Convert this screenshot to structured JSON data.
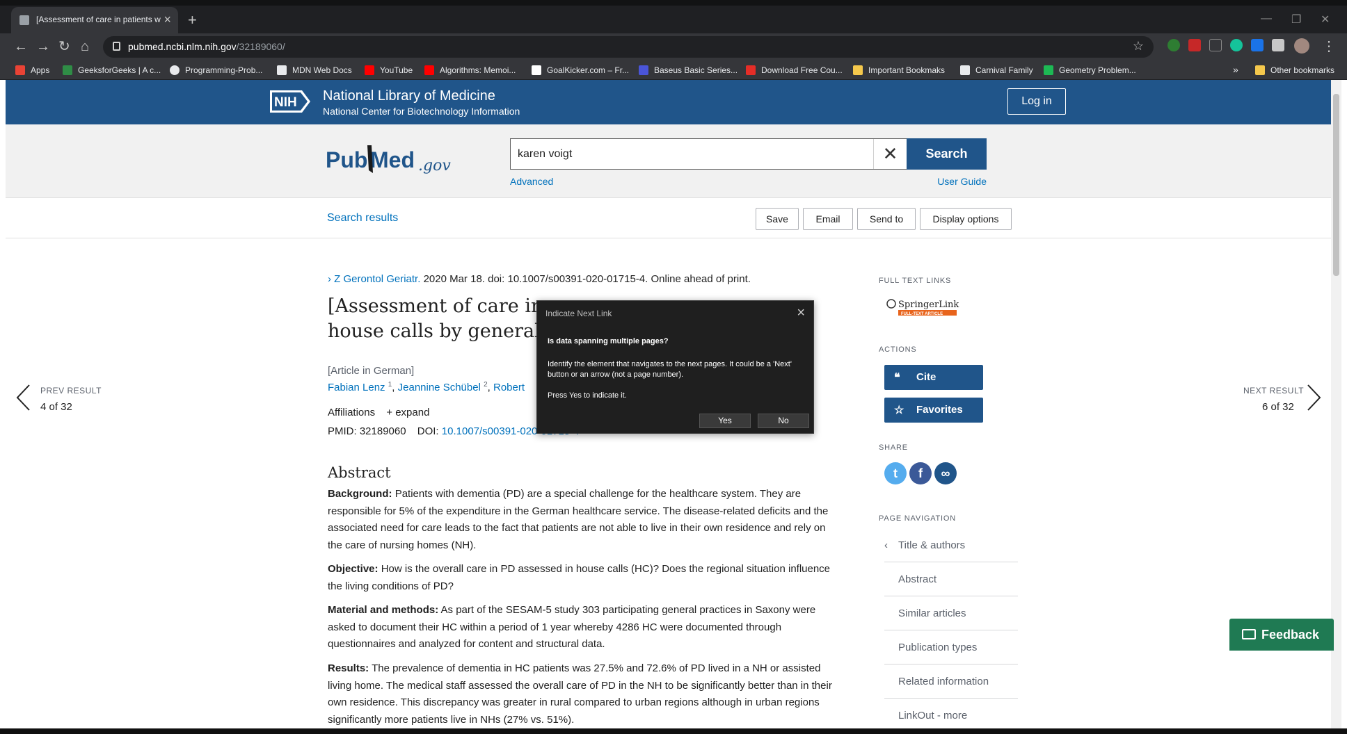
{
  "browser": {
    "tab_title": "[Assessment of care in patients w",
    "url_host": "pubmed.ncbi.nlm.nih.gov",
    "url_path": "/32189060/",
    "bookmarks": [
      {
        "label": "Apps",
        "color": "#ea4335"
      },
      {
        "label": "GeeksforGeeks | A c...",
        "color": "#2f8d46"
      },
      {
        "label": "Programming-Prob...",
        "color": "#e8eaed"
      },
      {
        "label": "MDN Web Docs",
        "color": "#e8eaed"
      },
      {
        "label": "YouTube",
        "color": "#ff0000"
      },
      {
        "label": "Algorithms: Memoi...",
        "color": "#ff0000"
      },
      {
        "label": "GoalKicker.com – Fr...",
        "color": "#ffffff"
      },
      {
        "label": "Baseus Basic Series...",
        "color": "#4a55d8"
      },
      {
        "label": "Download Free Cou...",
        "color": "#e52d27"
      },
      {
        "label": "Important Bookmaks",
        "color": "#f5c84c"
      },
      {
        "label": "Carnival Family",
        "color": "#e8eaed"
      },
      {
        "label": "Geometry Problem...",
        "color": "#1db954"
      }
    ],
    "more_bookmarks": "»",
    "other_bookmarks": "Other bookmarks"
  },
  "nih": {
    "logo": "NIH",
    "title": "National Library of Medicine",
    "subtitle": "National Center for Biotechnology Information",
    "login": "Log in"
  },
  "search": {
    "logo_pub": "Pub",
    "logo_med": "Med",
    "logo_gov": ".gov",
    "query": "karen voigt",
    "button": "Search",
    "advanced": "Advanced",
    "user_guide": "User Guide"
  },
  "actions_bar": {
    "search_results": "Search results",
    "save": "Save",
    "email": "Email",
    "send_to": "Send to",
    "display_options": "Display options"
  },
  "pagination": {
    "prev_label": "PREV RESULT",
    "prev_count": "4 of 32",
    "next_label": "NEXT RESULT",
    "next_count": "6 of 32"
  },
  "article": {
    "journal": "Z Gerontol Geriatr.",
    "citation": "2020 Mar 18. doi: 10.1007/s00391-020-01715-4. Online ahead of print.",
    "title_line1": "[Assessment of care in",
    "title_line2": "house calls by general",
    "language": "[Article in German]",
    "author1": "Fabian Lenz",
    "author1_sup": "1",
    "author2": "Jeannine Schübel",
    "author2_sup": "2",
    "author3": "Robert",
    "affiliations": "Affiliations",
    "expand": "expand",
    "pmid_label": "PMID:",
    "pmid": "32189060",
    "doi_label": "DOI:",
    "doi": "10.1007/s00391-020-01715-4",
    "abstract_heading": "Abstract",
    "sections": [
      {
        "label": "Background:",
        "text": "Patients with dementia (PD) are a special challenge for the healthcare system. They are responsible for 5% of the expenditure in the German healthcare service. The disease-related deficits and the associated need for care leads to the fact that patients are not able to live in their own residence and rely on the care of nursing homes (NH)."
      },
      {
        "label": "Objective:",
        "text": "How is the overall care in PD assessed in house calls (HC)? Does the regional situation influence the living conditions of PD?"
      },
      {
        "label": "Material and methods:",
        "text": "As part of the SESAM-5 study 303 participating general practices in Saxony were asked to document their HC within a period of 1 year whereby 4286 HC were documented through questionnaires and analyzed for content and structural data."
      },
      {
        "label": "Results:",
        "text": "The prevalence of dementia in HC patients was 27.5% and 72.6% of PD lived in a NH or assisted living home. The medical staff assessed the overall care of PD in the NH to be significantly better than in their own residence. This discrepancy was greater in rural compared to urban regions although in urban regions significantly more patients live in NHs (27% vs. 51%)."
      }
    ]
  },
  "sidebar": {
    "full_text_links": "FULL TEXT LINKS",
    "springer_name": "SpringerLink",
    "springer_tag": "FULL-TEXT ARTICLE",
    "actions": "ACTIONS",
    "cite": "Cite",
    "favorites": "Favorites",
    "share": "SHARE",
    "page_navigation": "PAGE NAVIGATION",
    "nav_items": [
      "Title & authors",
      "Abstract",
      "Similar articles",
      "Publication types",
      "Related information",
      "LinkOut - more"
    ]
  },
  "feedback": "Feedback",
  "dialog": {
    "title": "Indicate Next Link",
    "question": "Is data spanning multiple pages?",
    "body": "Identify the element that navigates to the next pages. It could be a 'Next' button or an arrow (not a page number).",
    "press": "Press Yes to indicate it.",
    "yes": "Yes",
    "no": "No"
  },
  "colors": {
    "nih_blue": "#20558a",
    "link_blue": "#0071bc",
    "feedback_green": "#1f7a53",
    "dialog_bg": "#1f1f1f"
  }
}
